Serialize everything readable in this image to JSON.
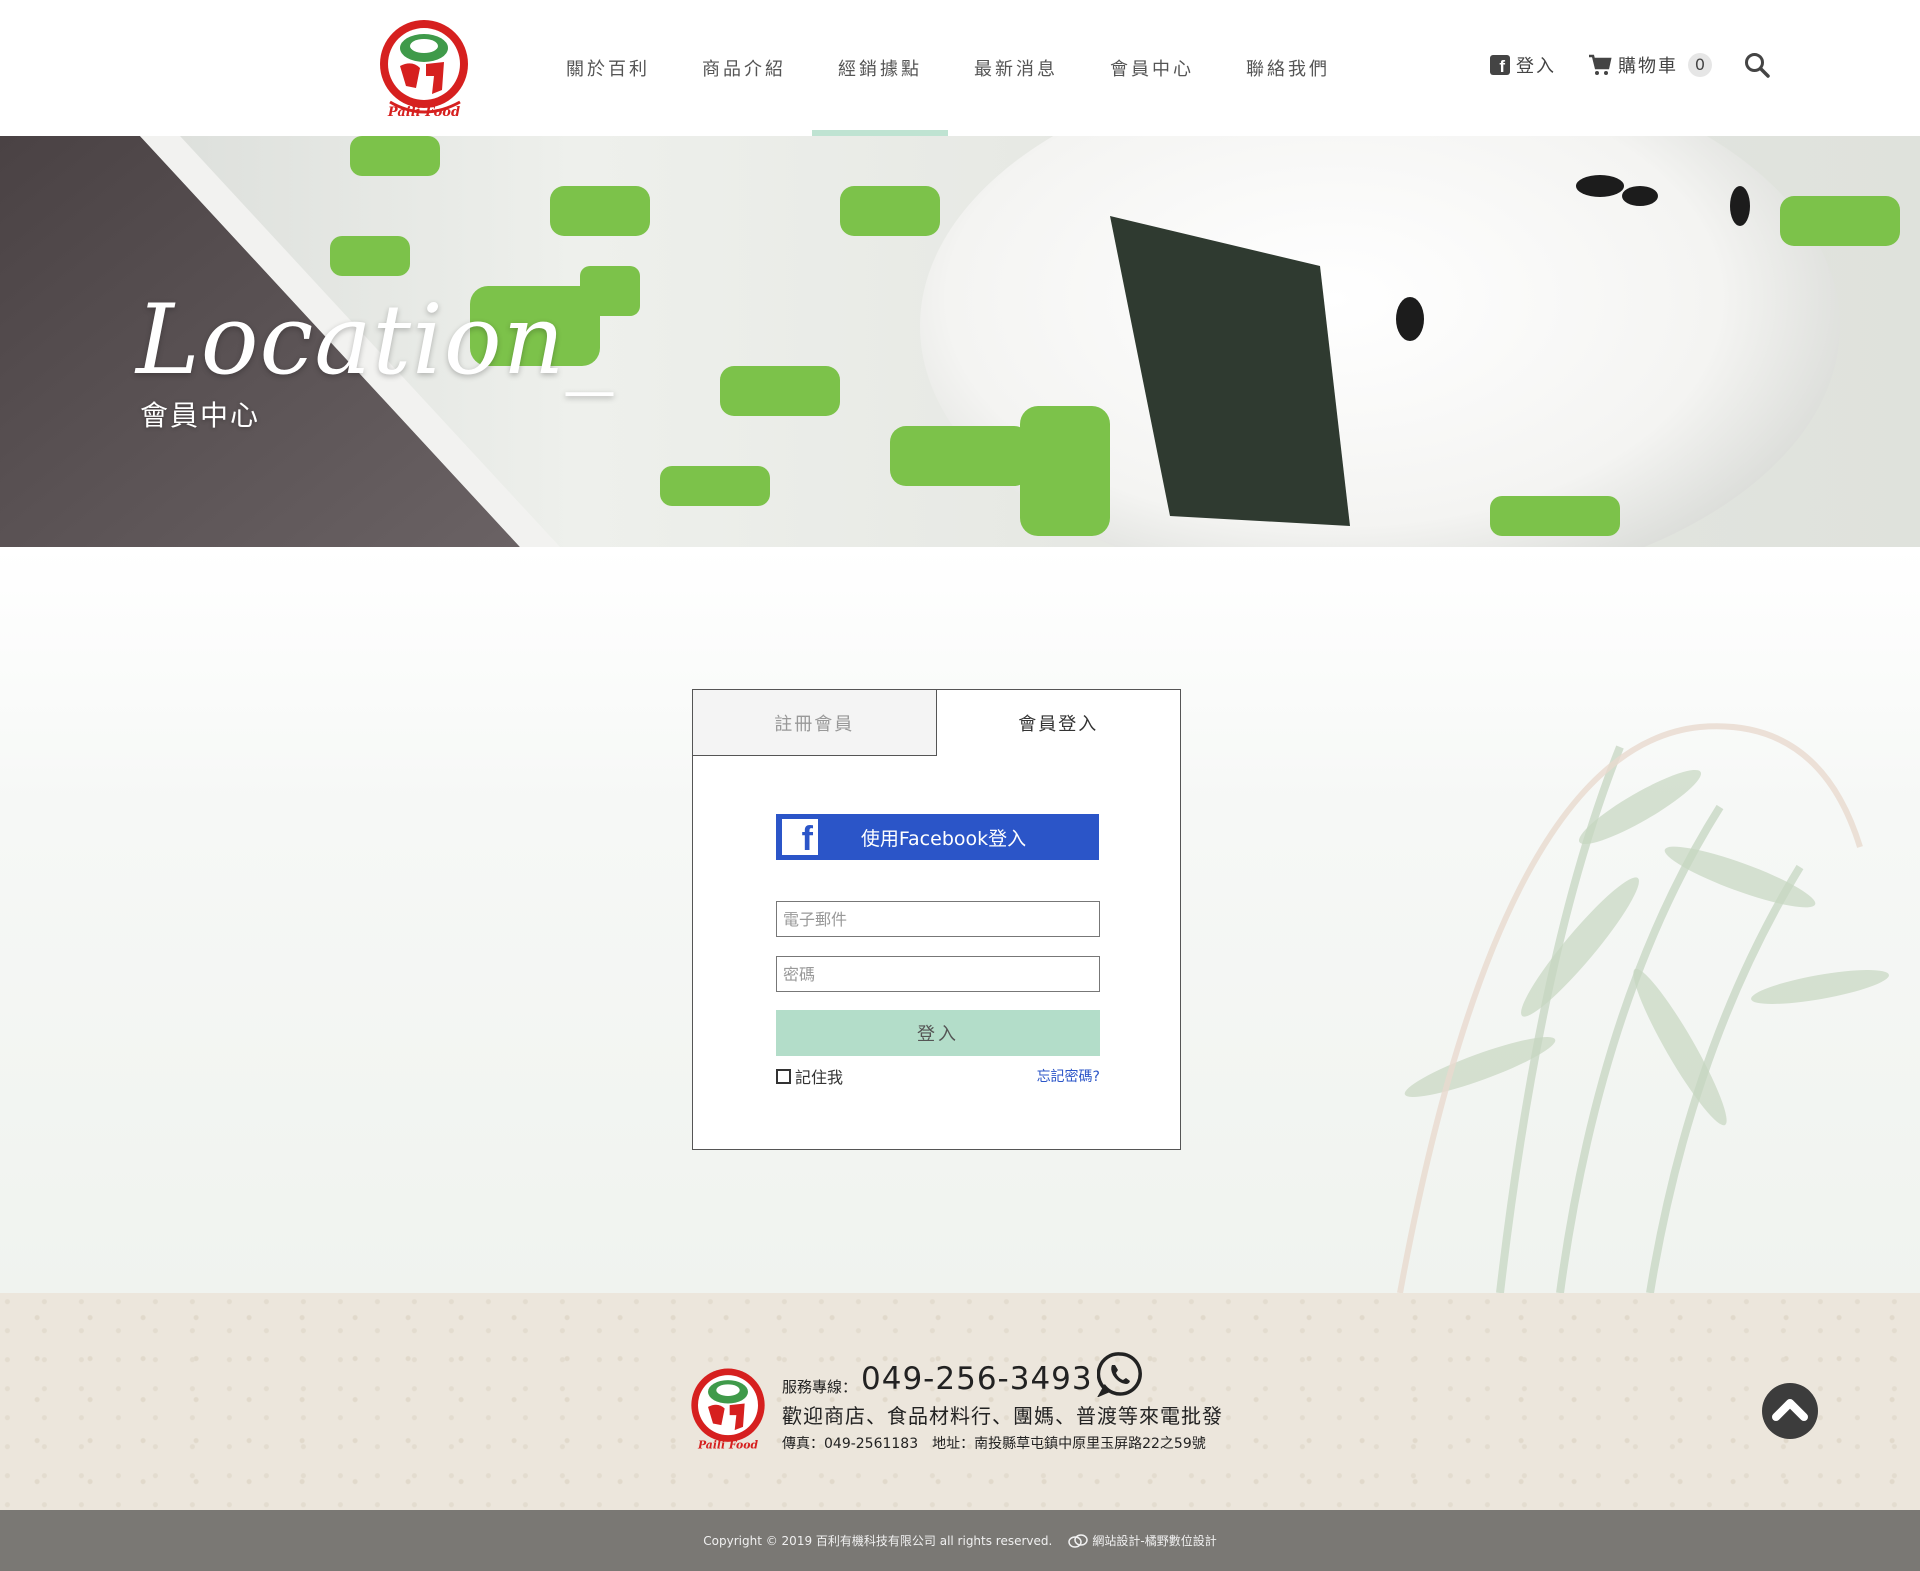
{
  "header": {
    "logo_text": "Paili Food",
    "nav": [
      {
        "label": "關於百利"
      },
      {
        "label": "商品介紹"
      },
      {
        "label": "經銷據點"
      },
      {
        "label": "最新消息"
      },
      {
        "label": "會員中心"
      },
      {
        "label": "聯絡我們"
      }
    ],
    "active_nav": "經銷據點",
    "login_label": "登入",
    "cart_label": "購物車",
    "cart_count": "0"
  },
  "hero": {
    "title": "Location_",
    "subtitle": "會員中心"
  },
  "login": {
    "tab_register": "註冊會員",
    "tab_login": "會員登入",
    "facebook_button": "使用Facebook登入",
    "email_placeholder": "電子郵件",
    "password_placeholder": "密碼",
    "submit_label": "登入",
    "remember_label": "記住我",
    "forgot_label": "忘記密碼?"
  },
  "footer": {
    "hotline_label": "服務專線：",
    "hotline_number": "049-256-3493",
    "welcome_text": "歡迎商店、食品材料行、團媽、普渡等來電批發",
    "contact_text": "傳真：049-2561183　地址：南投縣草屯鎮中原里玉屏路22之59號",
    "copyright": "Copyright © 2019 百利有機科技有限公司 all rights reserved.",
    "designer": "網站設計-橘野數位設計"
  },
  "colors": {
    "facebook_blue": "#2b55c8",
    "submit_mint": "#b3ddc9",
    "nav_active_bar": "#bfe3d2",
    "logo_red": "#d6201f"
  }
}
